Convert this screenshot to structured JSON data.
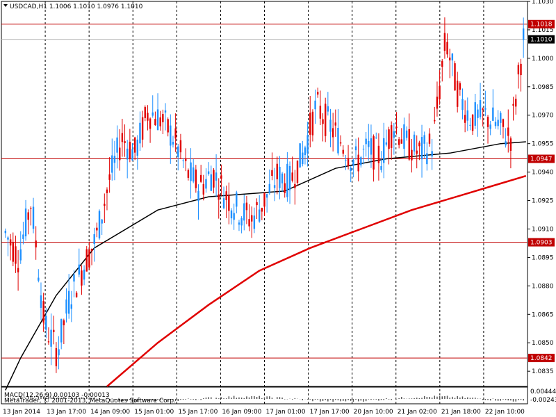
{
  "header": {
    "symbol_label": "USDCAD,H1  1.1006 1.1010 1.0976 1.1010"
  },
  "indicator": {
    "macd_label": "MACD(12,26,9) 0.00103 -0.00013",
    "macd_axis_top": "0.00444",
    "macd_axis_bottom": "-0.00243",
    "watermark": "MetaTrader, © 2001-2013, MetaQuotes Software Corp."
  },
  "colors": {
    "background": "#ffffff",
    "bull": "#1e90ff",
    "bear": "#e00000",
    "hline": "#c00000",
    "ma_fast": "#000000",
    "ma_slow": "#e00000",
    "current_price_tag": "#000000"
  },
  "chart_data": {
    "type": "candlestick",
    "symbol": "USDCAD",
    "timeframe": "H1",
    "y_range": [
      1.0827,
      1.103
    ],
    "price_ticks": [
      "1.1030",
      "1.1015",
      "1.1000",
      "1.0985",
      "1.0970",
      "1.0955",
      "1.0940",
      "1.0925",
      "1.0910",
      "1.0895",
      "1.0880",
      "1.0865",
      "1.0850",
      "1.0835"
    ],
    "time_ticks": [
      "13 Jan 2014",
      "13 Jan 17:00",
      "14 Jan 09:00",
      "15 Jan 01:00",
      "15 Jan 17:00",
      "16 Jan 09:00",
      "17 Jan 01:00",
      "17 Jan 17:00",
      "20 Jan 10:00",
      "21 Jan 02:00",
      "21 Jan 18:00",
      "22 Jan 10:00"
    ],
    "horizontal_levels": [
      {
        "value": 1.1018,
        "label": "1.1018"
      },
      {
        "value": 1.0947,
        "label": "1.0947"
      },
      {
        "value": 1.0903,
        "label": "1.0903"
      },
      {
        "value": 1.0842,
        "label": "1.0842"
      }
    ],
    "current_price": {
      "value": 1.101,
      "label": "1.1010"
    },
    "grid": "vertical dotted lines at time ticks",
    "candle_anchors": [
      [
        1.0908,
        1.0912
      ],
      [
        1.0895,
        1.0901
      ],
      [
        1.0925,
        1.092
      ],
      [
        1.086,
        1.0862
      ],
      [
        1.0845,
        1.085
      ],
      [
        1.0875,
        1.088
      ],
      [
        1.089,
        1.0893
      ],
      [
        1.0905,
        1.091
      ],
      [
        1.0935,
        1.094
      ],
      [
        1.0958,
        1.0952
      ],
      [
        1.095,
        1.0953
      ],
      [
        1.0972,
        1.0969
      ],
      [
        1.0968,
        1.097
      ],
      [
        1.0958,
        1.0956
      ],
      [
        1.094,
        1.0938
      ],
      [
        1.0932,
        1.0936
      ],
      [
        1.094,
        1.0935
      ],
      [
        1.0928,
        1.093
      ],
      [
        1.092,
        1.0918
      ],
      [
        1.0915,
        1.0917
      ],
      [
        1.0925,
        1.0928
      ],
      [
        1.0938,
        1.0935
      ],
      [
        1.0935,
        1.094
      ],
      [
        1.095,
        1.0955
      ],
      [
        1.0975,
        1.0972
      ],
      [
        1.0965,
        1.096
      ],
      [
        1.0955,
        1.095
      ],
      [
        1.0945,
        1.0948
      ],
      [
        1.0952,
        1.0949
      ],
      [
        1.0948,
        1.095
      ],
      [
        1.0965,
        1.0968
      ],
      [
        1.0955,
        1.0952
      ],
      [
        1.095,
        1.0953
      ],
      [
        1.0955,
        1.0958
      ],
      [
        1.101,
        1.1015
      ],
      [
        1.098,
        1.0975
      ],
      [
        1.0968,
        1.0965
      ],
      [
        1.097,
        1.0968
      ],
      [
        1.0965,
        1.0962
      ],
      [
        1.0958,
        1.0956
      ],
      [
        1.101,
        1.101
      ]
    ],
    "series": [
      {
        "label": "ma_fast",
        "anchors": [
          [
            0,
            1.0825
          ],
          [
            6,
            1.0842
          ],
          [
            20,
            1.0875
          ],
          [
            35,
            1.09
          ],
          [
            60,
            1.092
          ],
          [
            80,
            1.0927
          ],
          [
            110,
            1.093
          ],
          [
            130,
            1.0942
          ],
          [
            150,
            1.0947
          ],
          [
            175,
            1.095
          ],
          [
            195,
            1.0955
          ],
          [
            205,
            1.0956
          ]
        ]
      },
      {
        "label": "ma_slow",
        "anchors": [
          [
            40,
            1.0827
          ],
          [
            60,
            1.085
          ],
          [
            80,
            1.087
          ],
          [
            100,
            1.0888
          ],
          [
            120,
            1.09
          ],
          [
            140,
            1.091
          ],
          [
            160,
            1.092
          ],
          [
            180,
            1.0928
          ],
          [
            195,
            1.0934
          ],
          [
            205,
            1.0938
          ]
        ]
      }
    ],
    "macd_range": [
      -0.00243,
      0.00444
    ]
  }
}
